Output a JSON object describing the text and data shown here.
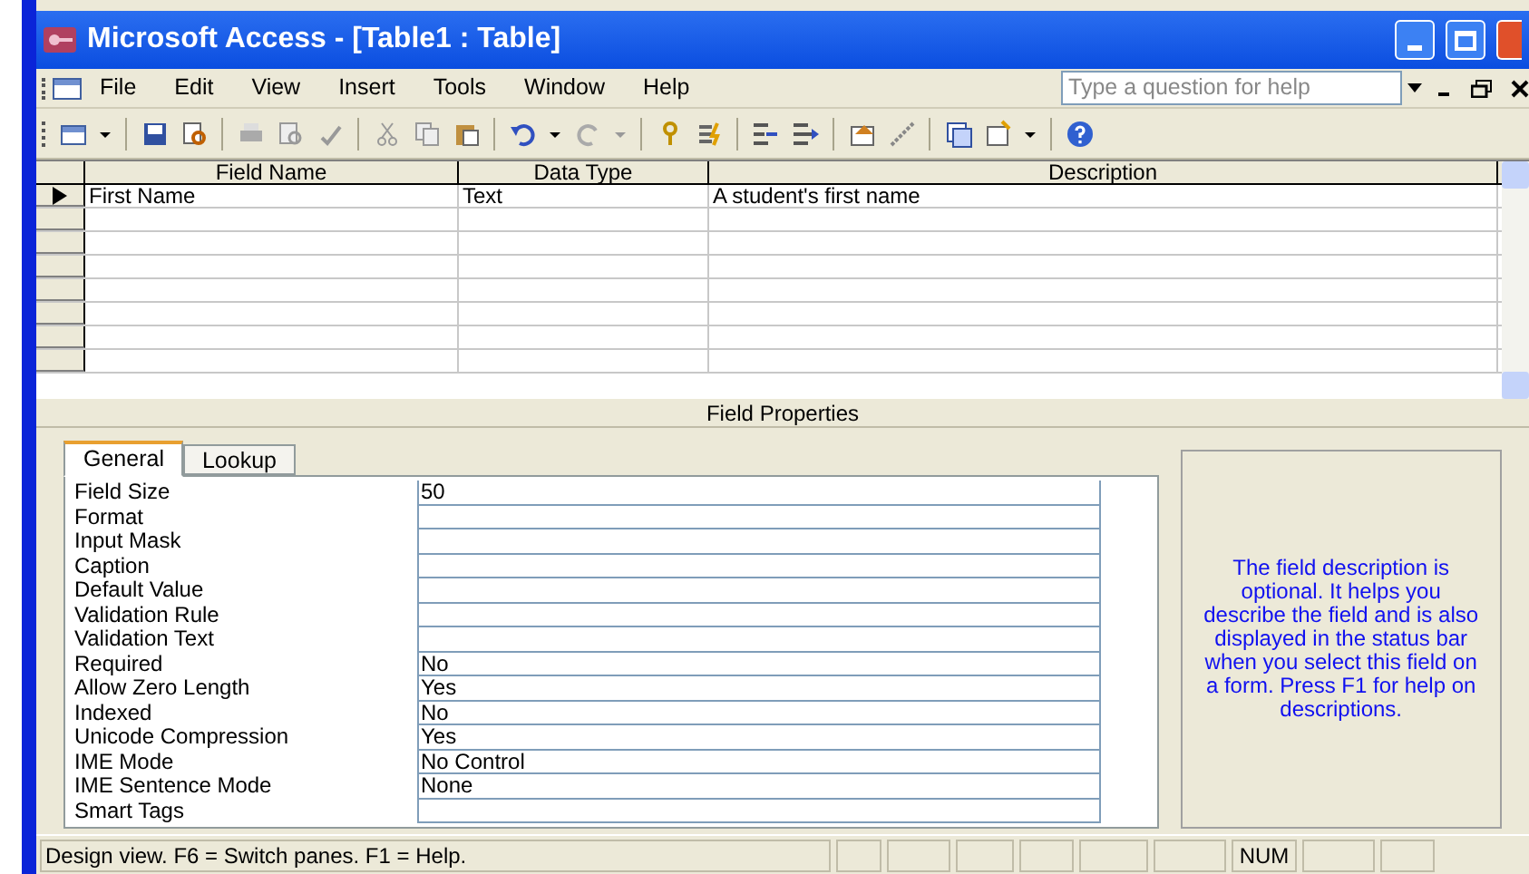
{
  "window": {
    "title": "Microsoft Access - [Table1 : Table]"
  },
  "menu": [
    "File",
    "Edit",
    "View",
    "Insert",
    "Tools",
    "Window",
    "Help"
  ],
  "help_box": {
    "placeholder": "Type a question for help"
  },
  "design_grid": {
    "columns": [
      "Field Name",
      "Data Type",
      "Description"
    ],
    "rows": [
      {
        "cells": [
          "First Name",
          "Text",
          "A student's first name"
        ],
        "current": true
      },
      {
        "cells": [],
        "current": false
      },
      {
        "cells": [],
        "current": false
      },
      {
        "cells": [],
        "current": false
      },
      {
        "cells": [],
        "current": false
      },
      {
        "cells": [],
        "current": false
      },
      {
        "cells": [],
        "current": false
      },
      {
        "cells": [],
        "current": false
      }
    ]
  },
  "field_properties": {
    "title": "Field Properties",
    "tabs": [
      {
        "label": "General",
        "selected": true
      },
      {
        "label": "Lookup",
        "selected": false
      }
    ],
    "properties": [
      {
        "name": "Field Size",
        "value": "50"
      },
      {
        "name": "Format"
      },
      {
        "name": "Input Mask"
      },
      {
        "name": "Caption"
      },
      {
        "name": "Default Value"
      },
      {
        "name": "Validation Rule"
      },
      {
        "name": "Validation Text"
      },
      {
        "name": "Required",
        "value": "No"
      },
      {
        "name": "Allow Zero Length",
        "value": "Yes"
      },
      {
        "name": "Indexed",
        "value": "No"
      },
      {
        "name": "Unicode Compression",
        "value": "Yes"
      },
      {
        "name": "IME Mode",
        "value": "No Control"
      },
      {
        "name": "IME Sentence Mode",
        "value": "None"
      },
      {
        "name": "Smart Tags"
      }
    ],
    "help_text": "The field description is optional.  It helps you describe the field and is also displayed in the status bar when you select this field on a form.  Press F1 for help on descriptions."
  },
  "status_bar": {
    "message": "Design view.  F6 = Switch panes.  F1 = Help.",
    "indicator": "NUM"
  }
}
